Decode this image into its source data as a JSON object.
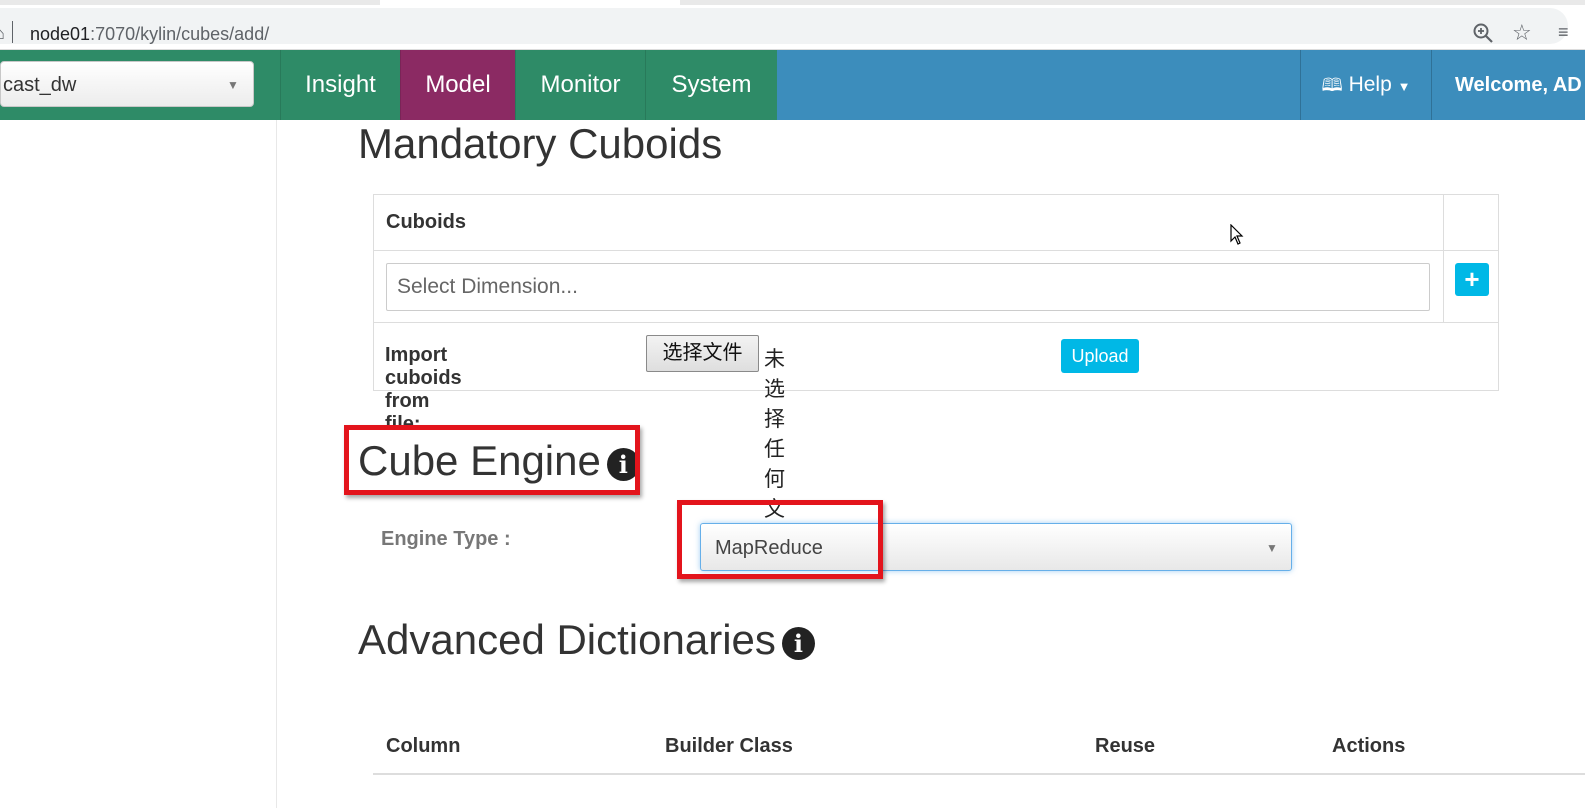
{
  "browser": {
    "url_host": "node01",
    "url_path": ":7070/kylin/cubes/add/"
  },
  "navbar": {
    "project": "cast_dw",
    "items": [
      {
        "label": "Insight"
      },
      {
        "label": "Model"
      },
      {
        "label": "Monitor"
      },
      {
        "label": "System"
      }
    ],
    "help_label": "Help",
    "welcome_label": "Welcome, AD"
  },
  "mandatory_cuboids": {
    "title": "Mandatory Cuboids",
    "column_header": "Cuboids",
    "dimension_placeholder": "Select Dimension...",
    "import_label": "Import cuboids from file:",
    "file_button_label": "选择文件",
    "file_status": "未选择任何文件",
    "upload_label": "Upload"
  },
  "cube_engine": {
    "title": "Cube Engine",
    "engine_type_label": "Engine Type :",
    "engine_value": "MapReduce"
  },
  "advanced_dictionaries": {
    "title": "Advanced Dictionaries",
    "columns": [
      "Column",
      "Builder Class",
      "Reuse",
      "Actions"
    ]
  },
  "colors": {
    "nav_blue": "#3c8dbc",
    "nav_green": "#2e8b67",
    "nav_model_active": "#8b2a63",
    "accent_button": "#00b8e6",
    "highlight_red": "#e3141c"
  }
}
